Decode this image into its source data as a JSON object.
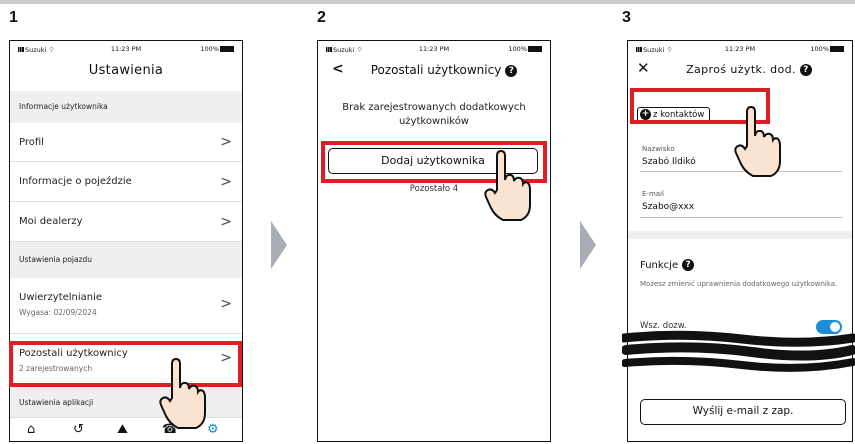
{
  "steps": [
    "1",
    "2",
    "3"
  ],
  "status": {
    "carrier": "Suzuki",
    "time": "11:23 PM",
    "battery": "100%"
  },
  "screen1": {
    "title": "Ustawienia",
    "section_user": "Informacje użytkownika",
    "profile": "Profil",
    "trip_info": "Informacje o pojeździe",
    "dealers": "Moi dealerzy",
    "section_vehicle": "Ustawienia pojazdu",
    "auth": "Uwierzytelnianie",
    "auth_sub": "Wygasa: 02/09/2024",
    "other_users": "Pozostali użytkownicy",
    "other_users_sub": "2 zarejestrowanych",
    "section_app": "Ustawienia aplikacji",
    "tabs": [
      "home-icon",
      "history-icon",
      "map-icon",
      "phone-icon",
      "settings-icon"
    ]
  },
  "screen2": {
    "title": "Pozostali użytkownicy",
    "empty_text": "Brak zarejestrowanych dodatkowych użytkowników",
    "add_button": "Dodaj użytkownika",
    "remaining": "Pozostało 4"
  },
  "screen3": {
    "title": "Zaproś użytk. dod.",
    "from_contacts": "z kontaktów",
    "surname_label": "Nazwisko",
    "surname_value": "Szabó Ildikó",
    "email_label": "E-mail",
    "email_value": "Szabo@xxx",
    "functions_label": "Funkcje",
    "functions_desc": "Możesz zmienić uprawnienia dodatkowego użytkownika.",
    "perm_label": "Wsz. dozw.",
    "send_button": "Wyślij e-mail z zap."
  },
  "colors": {
    "highlight": "#e01d25",
    "toggle": "#1a8fd8",
    "arrow": "#a9adb5"
  }
}
